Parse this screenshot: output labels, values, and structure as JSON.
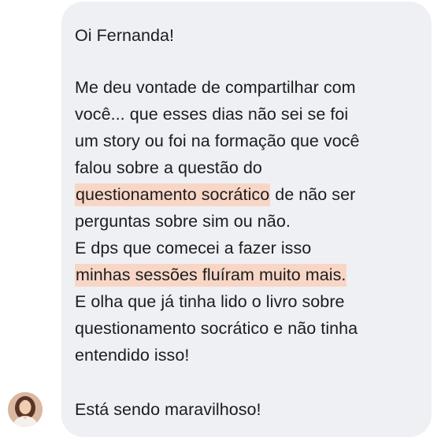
{
  "message": {
    "greeting": "Oi Fernanda!",
    "l1": "Me deu vontade de compartilhar com",
    "l2": "você... que esses dias não sei se foi",
    "l3": "um story ou foi na formação que você",
    "l4": "falou sobre a questão do",
    "l5_highlight": "questionamento socrático",
    "l5_rest": " de não ser",
    "l6": "perguntas sobre sim ou não.",
    "l7": "E dps que comecei a fazer isso",
    "l8_highlight": "minhas sessões fluíram muito mais.",
    "l9": "E olha que já tinha lido o livro sobre",
    "l10": "questionamento socrático e não tinha",
    "l11": "entendido isso!",
    "closing": "Está sendo maravilhoso!"
  },
  "colors": {
    "bubble_bg": "#eff0f4",
    "highlight": "#f8d6c6",
    "text": "#1c1c1e"
  },
  "icons": {
    "avatar": "sender-avatar"
  }
}
